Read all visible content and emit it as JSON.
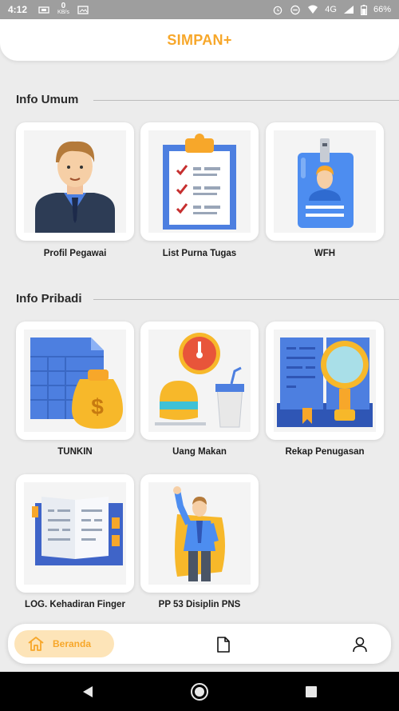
{
  "status_bar": {
    "time": "4:12",
    "speed": "0",
    "speed_unit": "KB/s",
    "network": "4G",
    "battery": "66%"
  },
  "header": {
    "title": "SIMPAN+"
  },
  "sections": [
    {
      "title": "Info Umum",
      "items": [
        {
          "label": "Profil Pegawai",
          "icon": "employee-profile-icon"
        },
        {
          "label": "List Purna Tugas",
          "icon": "clipboard-checklist-icon"
        },
        {
          "label": "WFH",
          "icon": "id-card-icon"
        }
      ]
    },
    {
      "title": "Info Pribadi",
      "items": [
        {
          "label": "TUNKIN",
          "icon": "money-bag-icon"
        },
        {
          "label": "Uang Makan",
          "icon": "meal-clock-icon"
        },
        {
          "label": "Rekap Penugasan",
          "icon": "book-magnifier-icon"
        },
        {
          "label": "LOG. Kehadiran Finger",
          "icon": "open-book-icon"
        },
        {
          "label": "PP 53 Disiplin PNS",
          "icon": "hero-icon"
        }
      ]
    }
  ],
  "bottom_nav": {
    "home_label": "Beranda",
    "home_icon": "home-icon",
    "doc_icon": "document-icon",
    "profile_icon": "user-icon"
  },
  "colors": {
    "accent": "#f7a72a",
    "accent_soft": "#fde4b8"
  }
}
